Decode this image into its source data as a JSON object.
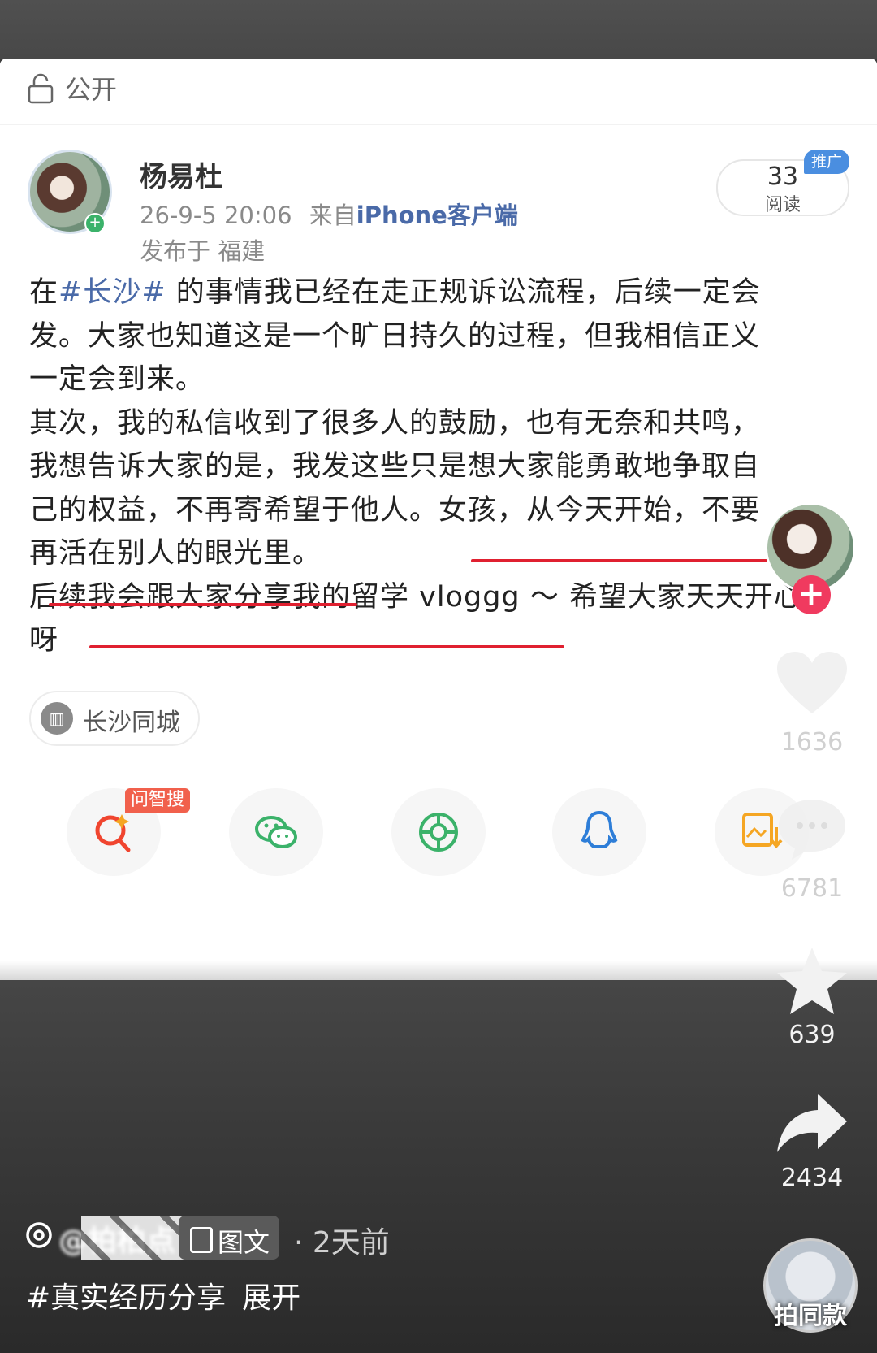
{
  "card": {
    "visibility_label": "公开",
    "user": {
      "name": "杨易杜"
    },
    "meta": {
      "time": "26-9-5 20:06",
      "from_prefix": "来自",
      "client": "iPhone客户端",
      "location": "发布于 福建"
    },
    "reads": {
      "count": "33",
      "label": "阅读",
      "promo": "推广"
    },
    "post": {
      "lines": [
        {
          "pre": "在",
          "tag": "#长沙#",
          "post": " 的事情我已经在走正规诉讼流程，后续一定会"
        },
        {
          "text": "发。大家也知道这是一个旷日持久的过程，但我相信正义"
        },
        {
          "text": "一定会到来。"
        },
        {
          "text": "其次，我的私信收到了很多人的鼓励，也有无奈和共鸣，"
        },
        {
          "text": "我想告诉大家的是，我发这些只是想大家能勇敢地争取自"
        },
        {
          "text": "己的权益，不再寄希望于他人。女孩，从今天开始，不要"
        },
        {
          "text": "再活在别人的眼光里。"
        },
        {
          "text": "后续我会跟大家分享我的留学 vloggg ～ 希望大家天天开心"
        },
        {
          "text": "呀"
        }
      ]
    },
    "chip": {
      "label": "长沙同城",
      "icon": "building-icon"
    },
    "share": {
      "ai_tag": "问智搜"
    }
  },
  "rail": {
    "like_count": "1636",
    "comment_count": "6781",
    "fav_count": "639",
    "share_count": "2434"
  },
  "footer": {
    "author": "@柏柏点",
    "type_label": "图文",
    "time": "· 2天前",
    "tag": "#真实经历分享",
    "expand": "展开",
    "same_style": "拍同款"
  }
}
